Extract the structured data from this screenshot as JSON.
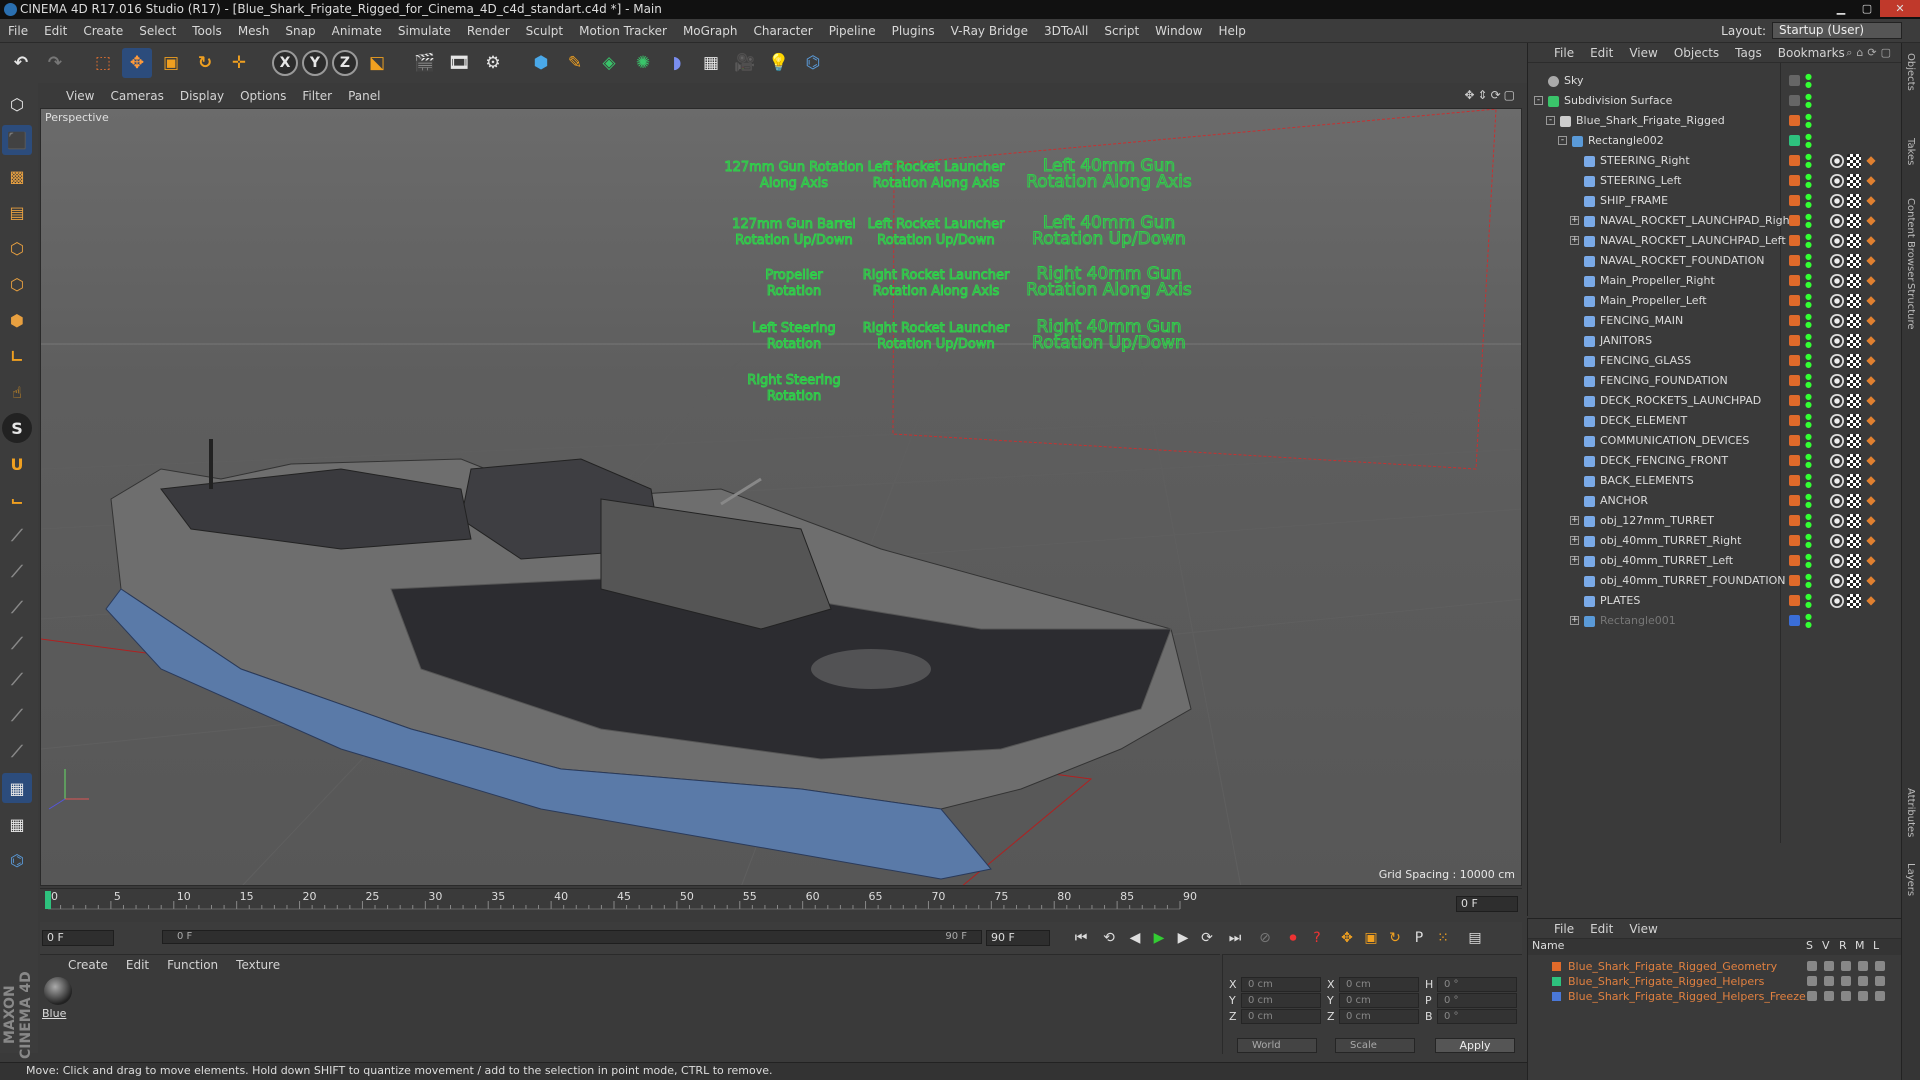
{
  "window": {
    "title": "CINEMA 4D R17.016 Studio (R17) - [Blue_Shark_Frigate_Rigged_for_Cinema_4D_c4d_standart.c4d *] - Main"
  },
  "menu": [
    "File",
    "Edit",
    "Create",
    "Select",
    "Tools",
    "Mesh",
    "Snap",
    "Animate",
    "Simulate",
    "Render",
    "Sculpt",
    "Motion Tracker",
    "MoGraph",
    "Character",
    "Pipeline",
    "Plugins",
    "V-Ray Bridge",
    "3DToAll",
    "Script",
    "Window",
    "Help"
  ],
  "layout": {
    "label": "Layout:",
    "value": "Startup (User)"
  },
  "viewport": {
    "menu": [
      "View",
      "Cameras",
      "Display",
      "Options",
      "Filter",
      "Panel"
    ],
    "camera_label": "Perspective",
    "grid_spacing": "Grid Spacing : 10000 cm",
    "helper_labels": [
      [
        "127mm Gun Rotation Along Axis",
        "Left Rocket Launcher Rotation Along Axis",
        "Left 40mm Gun Rotation Along Axis"
      ],
      [
        "127mm Gun Barrel Rotation Up/Down",
        "Left Rocket Launcher Rotation Up/Down",
        "Left 40mm Gun Rotation Up/Down"
      ],
      [
        "Propeller Rotation",
        "Right Rocket Launcher Rotation Along Axis",
        "Right 40mm Gun Rotation Along Axis"
      ],
      [
        "Left Steering Rotation",
        "Right Rocket Launcher Rotation Up/Down",
        "Right 40mm Gun Rotation Up/Down"
      ],
      [
        "Right Steering Rotation"
      ]
    ]
  },
  "timeline": {
    "ticks": [
      "0",
      "5",
      "10",
      "15",
      "20",
      "25",
      "30",
      "35",
      "40",
      "45",
      "50",
      "55",
      "60",
      "65",
      "70",
      "75",
      "80",
      "85",
      "90"
    ],
    "current_frame": "0 F",
    "start_field": "0 F",
    "scrub_start": "0 F",
    "scrub_end": "90 F",
    "end_field": "90 F"
  },
  "material": {
    "menu": [
      "Create",
      "Edit",
      "Function",
      "Texture"
    ],
    "name": "Blue"
  },
  "coords": {
    "rows": [
      {
        "a": "X",
        "av": "0 cm",
        "b": "X",
        "bv": "0 cm",
        "c": "H",
        "cv": "0 °"
      },
      {
        "a": "Y",
        "av": "0 cm",
        "b": "Y",
        "bv": "0 cm",
        "c": "P",
        "cv": "0 °"
      },
      {
        "a": "Z",
        "av": "0 cm",
        "b": "Z",
        "bv": "0 cm",
        "c": "B",
        "cv": "0 °"
      }
    ],
    "mode": "World",
    "scale": "Scale",
    "apply": "Apply"
  },
  "status": "Move: Click and drag to move elements. Hold down SHIFT to quantize movement / add to the selection in point mode, CTRL to remove.",
  "brand": "MAXON CINEMA 4D",
  "object_manager": {
    "menu": [
      "File",
      "Edit",
      "View",
      "Objects",
      "Tags",
      "Bookmarks"
    ],
    "objects": [
      {
        "name": "Sky",
        "depth": 0,
        "icon": "sky",
        "tag": "",
        "exp": ""
      },
      {
        "name": "Subdivision Surface",
        "depth": 0,
        "icon": "subdiv",
        "tag": "",
        "exp": "-"
      },
      {
        "name": "Blue_Shark_Frigate_Rigged",
        "depth": 1,
        "icon": "null",
        "tag": "#e06a2a",
        "exp": "-"
      },
      {
        "name": "Rectangle002",
        "depth": 2,
        "icon": "spline",
        "tag": "#2ec27e",
        "exp": "-"
      },
      {
        "name": "STEERING_Right",
        "depth": 3,
        "icon": "mesh",
        "tag": "#e06a2a",
        "exp": ""
      },
      {
        "name": "STEERING_Left",
        "depth": 3,
        "icon": "mesh",
        "tag": "#e06a2a",
        "exp": ""
      },
      {
        "name": "SHIP_FRAME",
        "depth": 3,
        "icon": "mesh",
        "tag": "#e06a2a",
        "exp": ""
      },
      {
        "name": "NAVAL_ROCKET_LAUNCHPAD_Right",
        "depth": 3,
        "icon": "mesh",
        "tag": "#e06a2a",
        "exp": "+"
      },
      {
        "name": "NAVAL_ROCKET_LAUNCHPAD_Left",
        "depth": 3,
        "icon": "mesh",
        "tag": "#e06a2a",
        "exp": "+"
      },
      {
        "name": "NAVAL_ROCKET_FOUNDATION",
        "depth": 3,
        "icon": "mesh",
        "tag": "#e06a2a",
        "exp": ""
      },
      {
        "name": "Main_Propeller_Right",
        "depth": 3,
        "icon": "mesh",
        "tag": "#e06a2a",
        "exp": ""
      },
      {
        "name": "Main_Propeller_Left",
        "depth": 3,
        "icon": "mesh",
        "tag": "#e06a2a",
        "exp": ""
      },
      {
        "name": "FENCING_MAIN",
        "depth": 3,
        "icon": "mesh",
        "tag": "#e06a2a",
        "exp": ""
      },
      {
        "name": "JANITORS",
        "depth": 3,
        "icon": "mesh",
        "tag": "#e06a2a",
        "exp": ""
      },
      {
        "name": "FENCING_GLASS",
        "depth": 3,
        "icon": "mesh",
        "tag": "#e06a2a",
        "exp": ""
      },
      {
        "name": "FENCING_FOUNDATION",
        "depth": 3,
        "icon": "mesh",
        "tag": "#e06a2a",
        "exp": ""
      },
      {
        "name": "DECK_ROCKETS_LAUNCHPAD",
        "depth": 3,
        "icon": "mesh",
        "tag": "#e06a2a",
        "exp": ""
      },
      {
        "name": "DECK_ELEMENT",
        "depth": 3,
        "icon": "mesh",
        "tag": "#e06a2a",
        "exp": ""
      },
      {
        "name": "COMMUNICATION_DEVICES",
        "depth": 3,
        "icon": "mesh",
        "tag": "#e06a2a",
        "exp": ""
      },
      {
        "name": "DECK_FENCING_FRONT",
        "depth": 3,
        "icon": "mesh",
        "tag": "#e06a2a",
        "exp": ""
      },
      {
        "name": "BACK_ELEMENTS",
        "depth": 3,
        "icon": "mesh",
        "tag": "#e06a2a",
        "exp": ""
      },
      {
        "name": "ANCHOR",
        "depth": 3,
        "icon": "mesh",
        "tag": "#e06a2a",
        "exp": ""
      },
      {
        "name": "obj_127mm_TURRET",
        "depth": 3,
        "icon": "mesh",
        "tag": "#e06a2a",
        "exp": "+"
      },
      {
        "name": "obj_40mm_TURRET_Right",
        "depth": 3,
        "icon": "mesh",
        "tag": "#e06a2a",
        "exp": "+"
      },
      {
        "name": "obj_40mm_TURRET_Left",
        "depth": 3,
        "icon": "mesh",
        "tag": "#e06a2a",
        "exp": "+"
      },
      {
        "name": "obj_40mm_TURRET_FOUNDATION",
        "depth": 3,
        "icon": "mesh",
        "tag": "#e06a2a",
        "exp": ""
      },
      {
        "name": "PLATES",
        "depth": 3,
        "icon": "mesh",
        "tag": "#e06a2a",
        "exp": ""
      },
      {
        "name": "Rectangle001",
        "depth": 3,
        "icon": "spline",
        "tag": "#3a6ed8",
        "exp": "+"
      }
    ]
  },
  "layer_manager": {
    "menu": [
      "File",
      "Edit",
      "View"
    ],
    "header": {
      "name": "Name",
      "s": "S",
      "v": "V",
      "r": "R",
      "m": "M",
      "l": "L"
    },
    "layers": [
      {
        "name": "Blue_Shark_Frigate_Rigged_Geometry",
        "color": "#e06a2a"
      },
      {
        "name": "Blue_Shark_Frigate_Rigged_Helpers",
        "color": "#2ec27e"
      },
      {
        "name": "Blue_Shark_Frigate_Rigged_Helpers_Freeze",
        "color": "#4a78d8"
      }
    ]
  },
  "side_tabs": [
    "Objects",
    "Takes",
    "Content Browser",
    "Structure",
    "Attributes",
    "Layers"
  ]
}
